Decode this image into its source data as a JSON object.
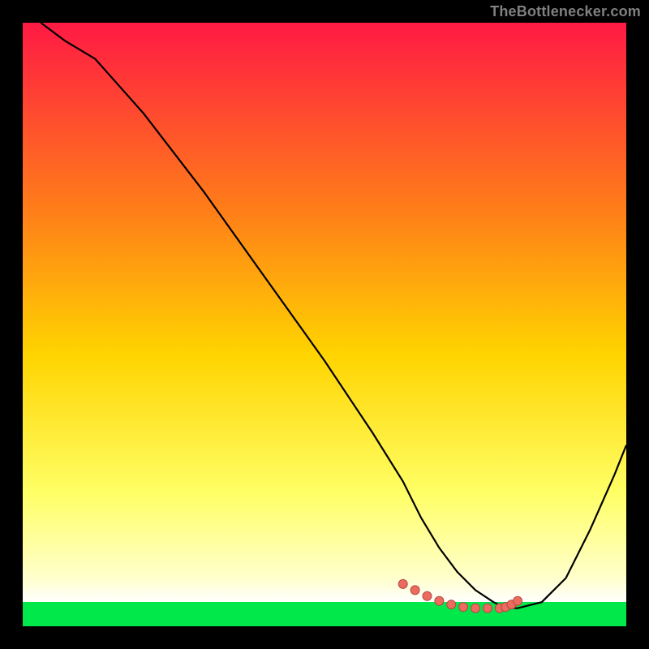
{
  "attribution": "TheBottlenecker.com",
  "colors": {
    "gradient_top": "#ff1a44",
    "gradient_upper_mid": "#ff7a1a",
    "gradient_mid": "#ffd400",
    "gradient_lower_mid": "#ffff66",
    "gradient_low": "#ffffcc",
    "gradient_band": "#00e84a",
    "curve": "#000000",
    "marker": "#ed6a5e",
    "marker_stroke": "#b24a42"
  },
  "chart_data": {
    "type": "line",
    "title": "",
    "xlabel": "",
    "ylabel": "",
    "xlim": [
      0,
      100
    ],
    "ylim": [
      0,
      100
    ],
    "series": [
      {
        "name": "bottleneck-curve",
        "x": [
          3,
          7,
          12,
          20,
          30,
          40,
          50,
          58,
          63,
          66,
          69,
          72,
          75,
          78,
          80,
          82,
          86,
          90,
          94,
          98,
          100
        ],
        "y": [
          100,
          97,
          94,
          85,
          72,
          58,
          44,
          32,
          24,
          18,
          13,
          9,
          6,
          4,
          3,
          3,
          4,
          8,
          16,
          25,
          30
        ]
      }
    ],
    "markers": {
      "name": "highlight-points",
      "x": [
        63,
        65,
        67,
        69,
        71,
        73,
        75,
        77,
        79,
        80,
        81,
        82
      ],
      "y": [
        7,
        6,
        5,
        4.2,
        3.6,
        3.2,
        3.0,
        3.0,
        3.0,
        3.2,
        3.6,
        4.2
      ]
    }
  }
}
